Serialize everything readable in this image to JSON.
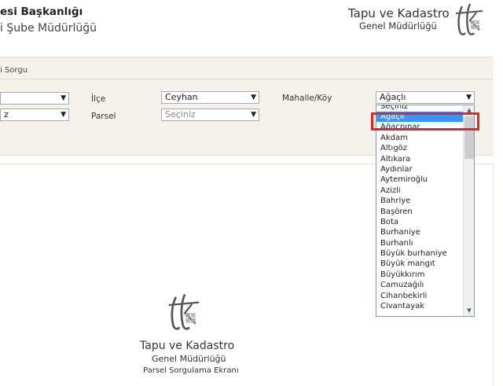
{
  "header": {
    "title": "esi Başkanlığı",
    "subtitle": "i Şube Müdürlüğü",
    "brand_name": "Tapu ve Kadastro",
    "brand_sub": "Genel Müdürlüğü",
    "logo_icon": "tkgm-logo-icon"
  },
  "query_panel": {
    "title": "i Sorgu",
    "row1": {
      "left_select_value": "",
      "ilce_label": "İlçe",
      "ilce_value": "Ceyhan",
      "mahalle_label": "Mahalle/Köy",
      "mahalle_value": "Ağaçlı"
    },
    "row2": {
      "left_select_value": "z",
      "parsel_label": "Parsel",
      "parsel_placeholder": "Seçiniz"
    }
  },
  "dropdown": {
    "items": [
      "Seçiniz",
      "Ağaçlı",
      "Ağaçpınar",
      "Akdam",
      "Altıgöz",
      "Altıkara",
      "Aydınlar",
      "Aytemiroğlu",
      "Azizli",
      "Bahriye",
      "Başören",
      "Bota",
      "Burhaniye",
      "Burhanlı",
      "Büyük burhaniye",
      "Büyük mangıt",
      "Büyükkırım",
      "Camuzağılı",
      "Cihanbekirli",
      "Civantayak"
    ],
    "selected_index": 1
  },
  "content": {
    "brand_name": "Tapu ve Kadastro",
    "brand_sub": "Genel Müdürlüğü",
    "screen_name": "Parsel Sorgulama Ekranı"
  },
  "colors": {
    "panel_bg": "#f4f2ea",
    "selection": "#3399ff",
    "highlight": "#e3262b"
  }
}
